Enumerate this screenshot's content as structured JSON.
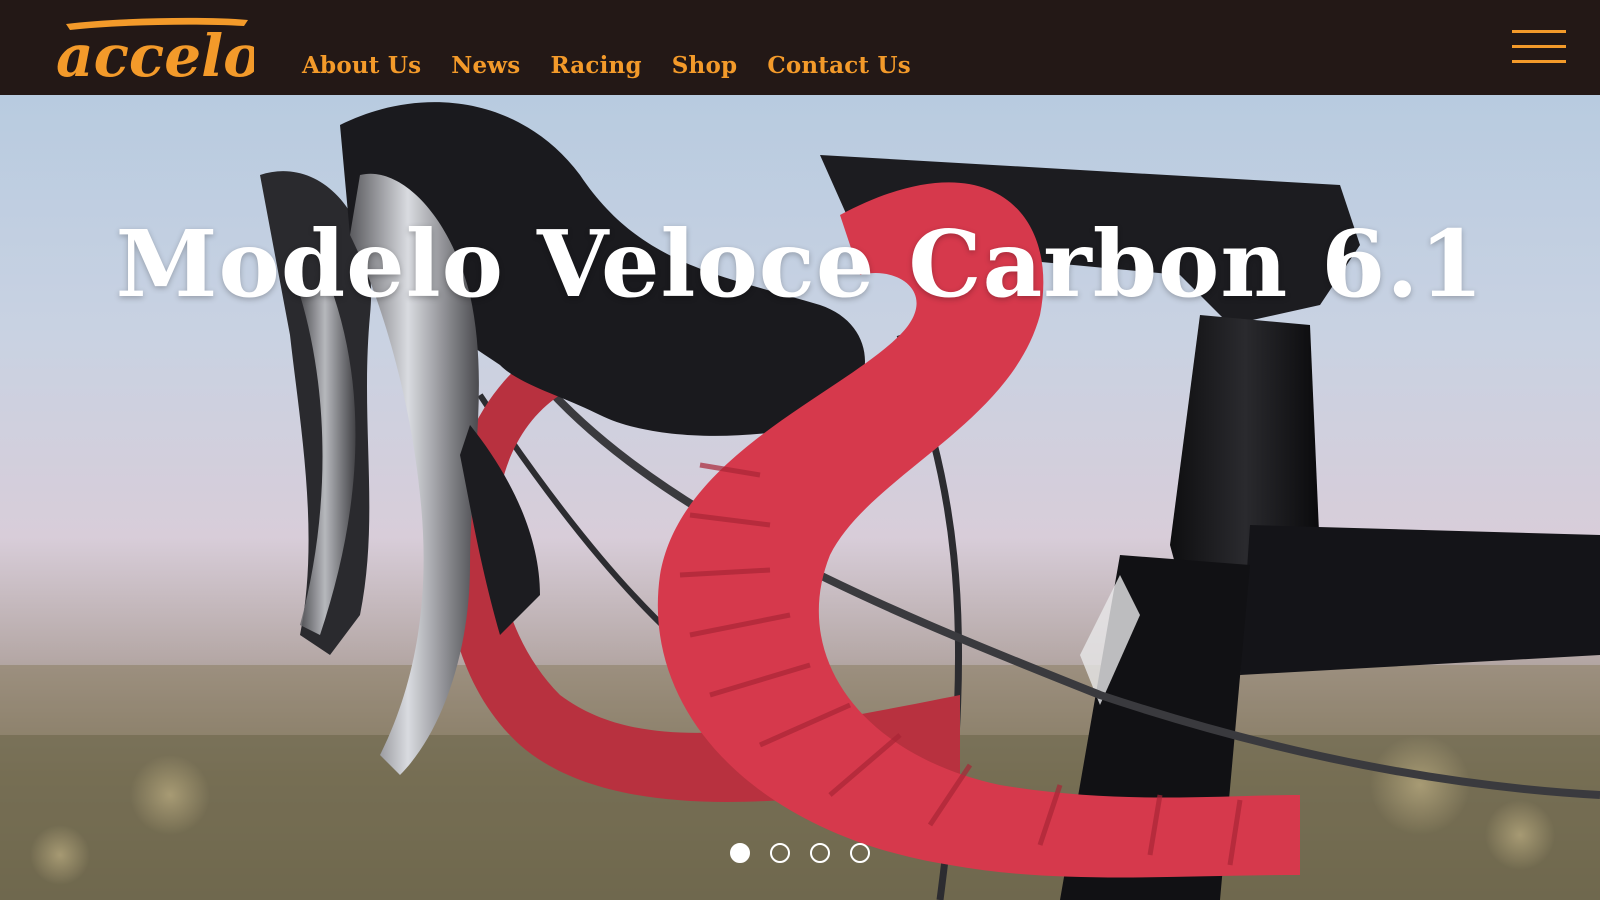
{
  "brand": {
    "logo_text": "accelo",
    "accent_color": "#f39a2a",
    "header_bg": "#231816"
  },
  "nav": {
    "items": [
      {
        "label": "About Us"
      },
      {
        "label": "News"
      },
      {
        "label": "Racing"
      },
      {
        "label": "Shop"
      },
      {
        "label": "Contact Us"
      }
    ],
    "menu_icon": "hamburger-menu-icon"
  },
  "hero": {
    "title": "Modelo Veloce Carbon 6.1",
    "image_subject": "bicycle-handlebar-image",
    "slides_total": 4,
    "active_slide": 1
  }
}
